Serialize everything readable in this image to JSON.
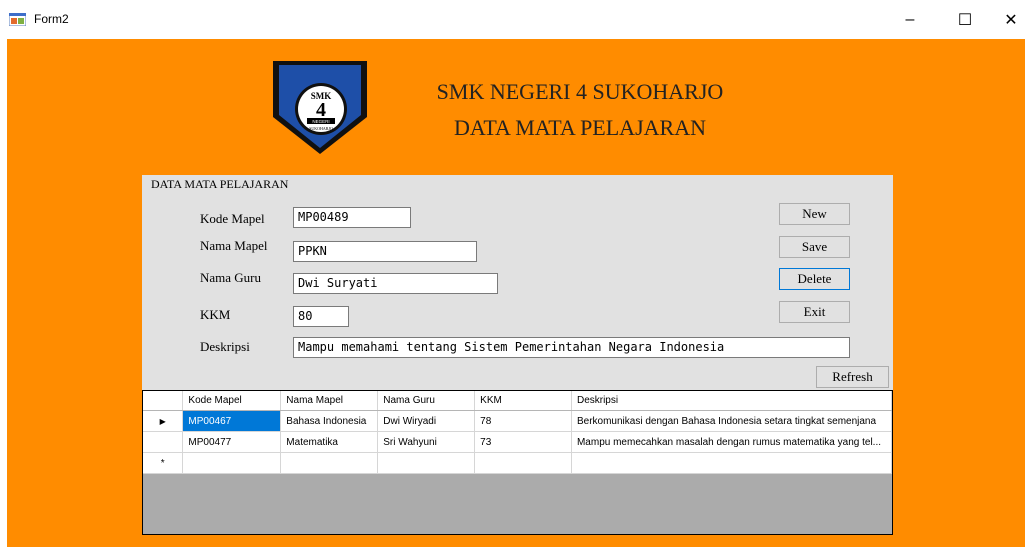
{
  "window": {
    "title": "Form2",
    "minimize": "–",
    "maximize": "☐",
    "close": "✕"
  },
  "header": {
    "line1": "SMK NEGERI 4 SUKOHARJO",
    "line2": "DATA MATA PELAJARAN"
  },
  "logo": {
    "top_text": "SMK",
    "number": "4",
    "band_text": "NEGERI",
    "bottom_text": "SUKOHARJO"
  },
  "form": {
    "group_title": "DATA MATA PELAJARAN",
    "kode_label": "Kode Mapel",
    "kode_value": "MP00489",
    "nama_mapel_label": "Nama Mapel",
    "nama_mapel_value": "PPKN",
    "nama_guru_label": "Nama Guru",
    "nama_guru_value": "Dwi Suryati",
    "kkm_label": "KKM",
    "kkm_value": "80",
    "deskripsi_label": "Deskripsi",
    "deskripsi_value": "Mampu memahami tentang Sistem Pemerintahan Negara Indonesia"
  },
  "buttons": {
    "new": "New",
    "save": "Save",
    "delete": "Delete",
    "exit": "Exit",
    "refresh": "Refresh"
  },
  "grid": {
    "columns": [
      "Kode Mapel",
      "Nama Mapel",
      "Nama Guru",
      "KKM",
      "Deskripsi"
    ],
    "rows": [
      {
        "indicator": "▶",
        "kode": "MP00467",
        "nama_mapel": "Bahasa Indonesia",
        "nama_guru": "Dwi Wiryadi",
        "kkm": "78",
        "deskripsi": "Berkomunikasi dengan Bahasa Indonesia setara tingkat semenjana"
      },
      {
        "indicator": "",
        "kode": "MP00477",
        "nama_mapel": "Matematika",
        "nama_guru": "Sri Wahyuni",
        "kkm": "73",
        "deskripsi": "Mampu memecahkan masalah dengan rumus matematika yang tel..."
      }
    ],
    "new_row_indicator": "*"
  },
  "colors": {
    "form_background": "#ff8c00",
    "selection": "#0078d7",
    "logo_blue": "#1e4fa8"
  }
}
